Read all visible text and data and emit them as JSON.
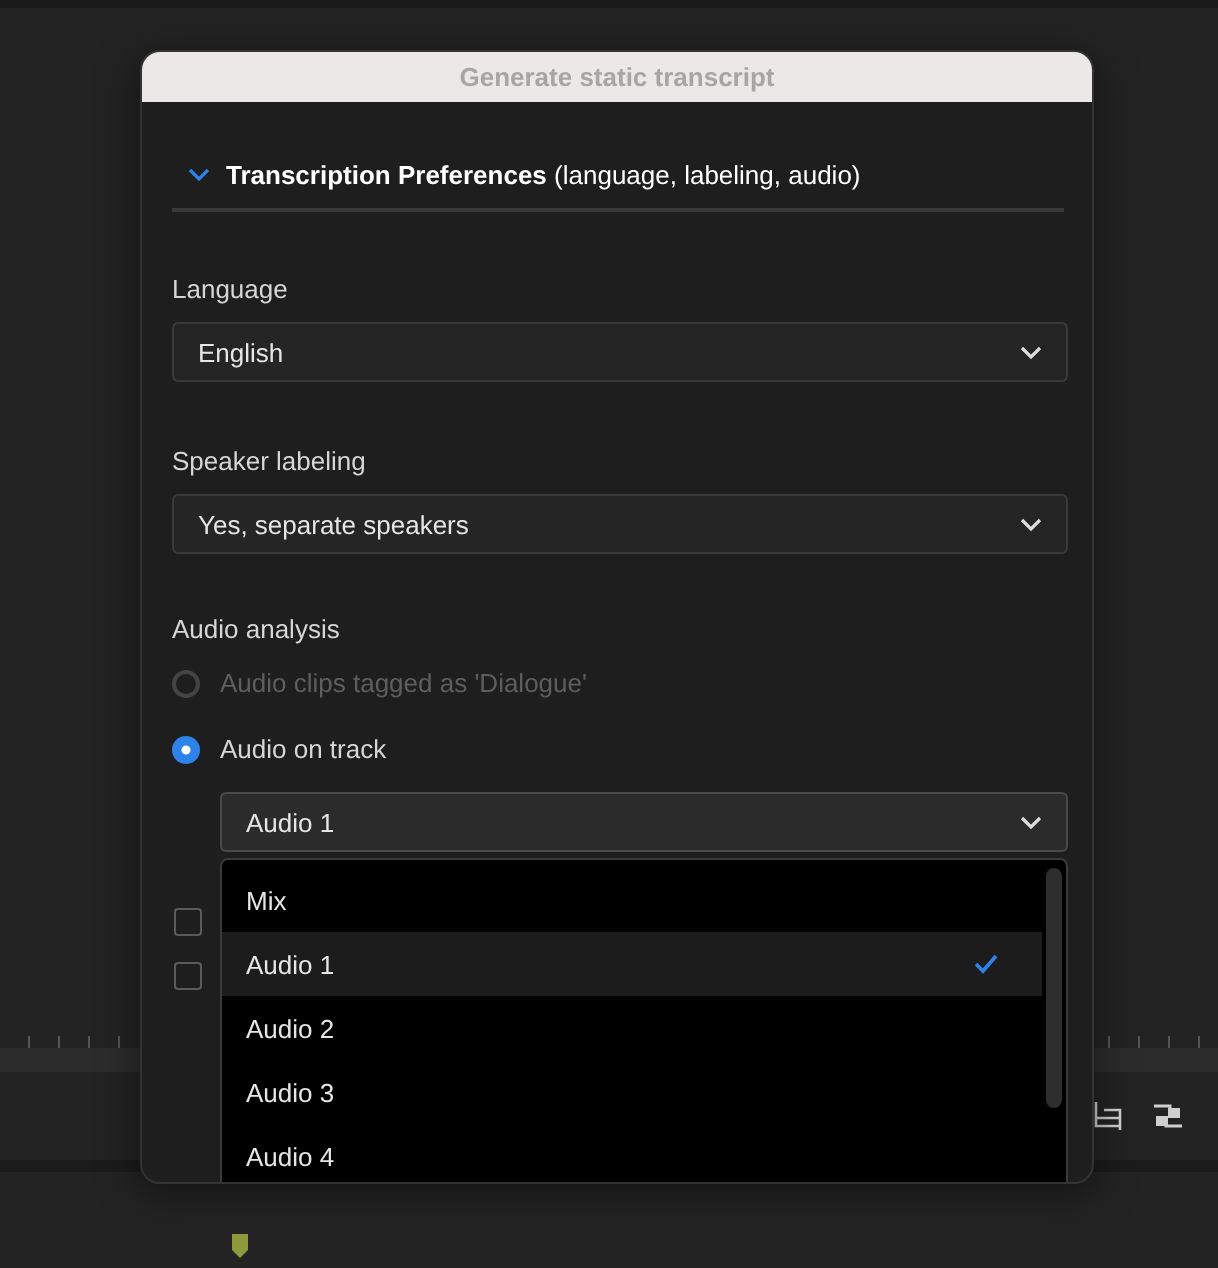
{
  "dialog": {
    "title": "Generate static transcript",
    "section": {
      "title": "Transcription Preferences",
      "subtitle": "(language, labeling, audio)",
      "expanded": true
    },
    "language": {
      "label": "Language",
      "value": "English"
    },
    "speaker_labeling": {
      "label": "Speaker labeling",
      "value": "Yes, separate speakers"
    },
    "audio_analysis": {
      "label": "Audio analysis",
      "options": [
        {
          "label": "Audio clips tagged as 'Dialogue'",
          "selected": false,
          "disabled": true
        },
        {
          "label": "Audio on track",
          "selected": true,
          "disabled": false
        }
      ],
      "track": {
        "value": "Audio 1",
        "expanded": true,
        "options": [
          {
            "label": "Mix",
            "selected": false
          },
          {
            "label": "Audio 1",
            "selected": true
          },
          {
            "label": "Audio 2",
            "selected": false
          },
          {
            "label": "Audio 3",
            "selected": false
          },
          {
            "label": "Audio 4",
            "selected": false
          }
        ]
      }
    },
    "checkboxes": [
      {
        "checked": false
      },
      {
        "checked": false
      }
    ]
  }
}
